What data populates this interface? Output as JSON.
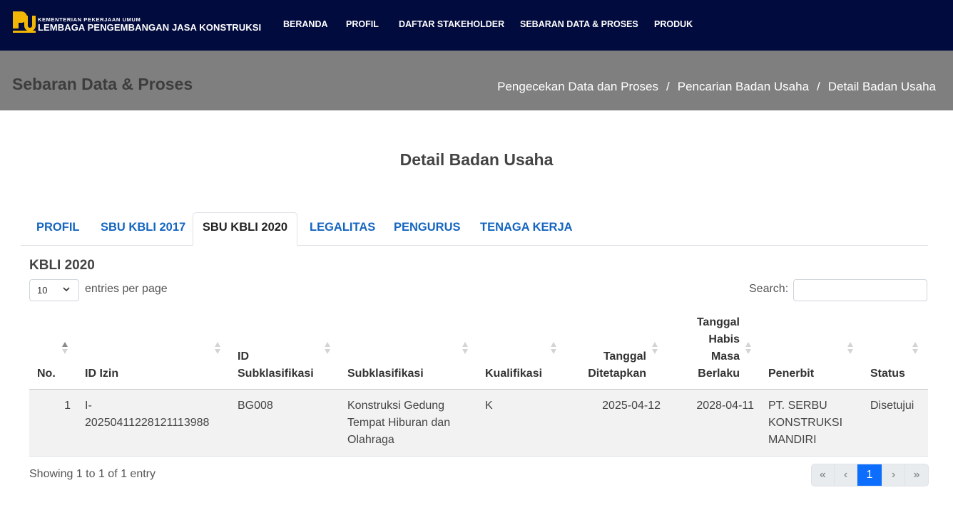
{
  "header": {
    "brand_small": "KEMENTERIAN PEKERJAAN UMUM",
    "brand_big": "LEMBAGA PENGEMBANGAN JASA KONSTRUKSI",
    "nav": [
      "BERANDA",
      "PROFIL",
      "DAFTAR STAKEHOLDER",
      "SEBARAN DATA & PROSES",
      "PRODUK"
    ]
  },
  "hero": {
    "title": "Sebaran Data & Proses",
    "breadcrumb": [
      "Pengecekan Data dan Proses",
      "Pencarian Badan Usaha",
      "Detail Badan Usaha"
    ],
    "separator": "/"
  },
  "page_title": "Detail Badan Usaha",
  "tabs": [
    {
      "label": "PROFIL",
      "active": false
    },
    {
      "label": "SBU KBLI 2017",
      "active": false
    },
    {
      "label": "SBU KBLI 2020",
      "active": true
    },
    {
      "label": "LEGALITAS",
      "active": false
    },
    {
      "label": "PENGURUS",
      "active": false
    },
    {
      "label": "TENAGA KERJA",
      "active": false
    }
  ],
  "section_title": "KBLI 2020",
  "table_controls": {
    "page_length": "10",
    "length_label": "entries per page",
    "search_label": "Search:",
    "search_value": ""
  },
  "table": {
    "columns": [
      {
        "lines": [
          "No."
        ]
      },
      {
        "lines": [
          "ID Izin"
        ]
      },
      {
        "lines": [
          "ID",
          "Subklasifikasi"
        ]
      },
      {
        "lines": [
          "Subklasifikasi"
        ]
      },
      {
        "lines": [
          "Kualifikasi"
        ]
      },
      {
        "lines": [
          "Tanggal",
          "Ditetapkan"
        ]
      },
      {
        "lines": [
          "Tanggal",
          "Habis",
          "Masa",
          "Berlaku"
        ]
      },
      {
        "lines": [
          "Penerbit"
        ]
      },
      {
        "lines": [
          "Status"
        ]
      }
    ],
    "rows": [
      {
        "no": "1",
        "id_izin": [
          "I-",
          "20250411228121113988"
        ],
        "id_subklasifikasi": [
          "BG008"
        ],
        "subklasifikasi": [
          "Konstruksi Gedung",
          "Tempat Hiburan dan",
          "Olahraga"
        ],
        "kualifikasi": [
          "K"
        ],
        "tanggal_ditetapkan": [
          "2025-04-12"
        ],
        "tanggal_habis": [
          "2028-04-11"
        ],
        "penerbit": [
          "PT. SERBU",
          "KONSTRUKSI",
          "MANDIRI"
        ],
        "status": [
          "Disetujui"
        ]
      }
    ]
  },
  "info": "Showing 1 to 1 of 1 entry",
  "pagination": {
    "first": "«",
    "prev": "‹",
    "current": "1",
    "next": "›",
    "last": "»"
  },
  "colors": {
    "navbar": "#020b3e",
    "hero": "#7f7f7f",
    "tab_link": "#1565c0",
    "active_page": "#0d6efd",
    "logo_gold": "#f2b705"
  }
}
